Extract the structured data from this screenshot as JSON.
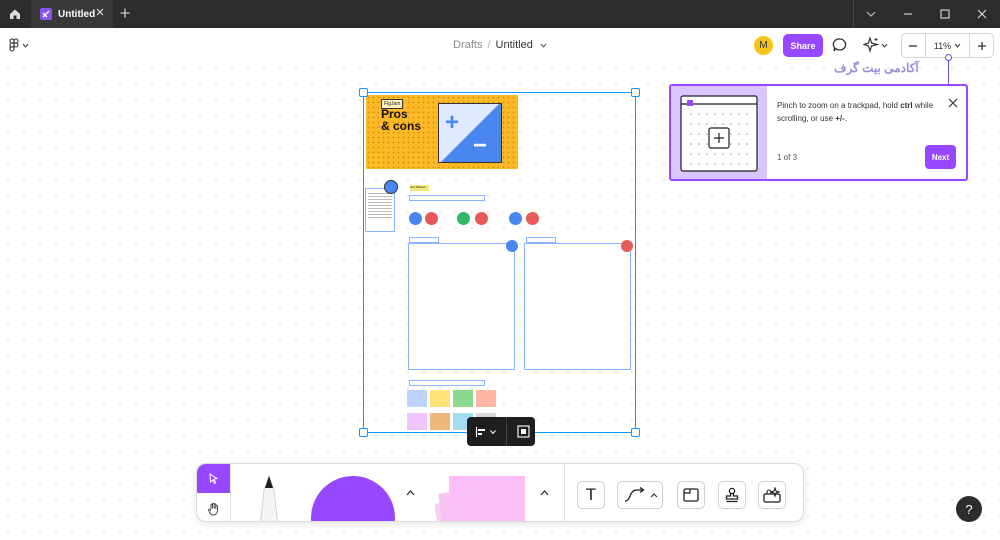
{
  "tab": {
    "title": "Untitled"
  },
  "breadcrumb": {
    "folder": "Drafts",
    "separator": "/",
    "file": "Untitled"
  },
  "header": {
    "avatar_initial": "M",
    "share_label": "Share",
    "zoom_level": "11%"
  },
  "template": {
    "badge": "FigJam",
    "title_line1": "Pros",
    "title_line2": "& cons",
    "section_label": "Get Started"
  },
  "onboarding": {
    "text_prefix": "Pinch to zoom on a trackpad, hold ",
    "key_ctrl": "ctrl",
    "text_middle": " while scrolling, or use ",
    "key_plusminus": "+/-",
    "text_suffix": ".",
    "step": "1 of 3",
    "next_label": "Next"
  },
  "watermark": {
    "text": "آکادمی بیت گرف"
  },
  "toolbar": {
    "text_tool_glyph": "T"
  },
  "help": {
    "label": "?"
  },
  "colors": {
    "accent": "#9747ff",
    "selection": "#0d99ff",
    "hero_bg": "#fdb927",
    "onboarding_illustration": "#d9c6ff"
  },
  "icons": [
    "home-icon",
    "figjam-logo-icon",
    "close-icon",
    "plus-icon",
    "minimize-icon",
    "maximize-icon",
    "chevron-down-icon",
    "figma-menu-icon",
    "comment-icon",
    "ai-sparkle-icon",
    "minus-icon",
    "align-left-icon",
    "frame-fit-icon",
    "cursor-icon",
    "hand-icon",
    "marker-icon",
    "chevron-up-icon",
    "text-icon",
    "connector-icon",
    "section-icon",
    "stamp-icon",
    "widget-icon"
  ]
}
